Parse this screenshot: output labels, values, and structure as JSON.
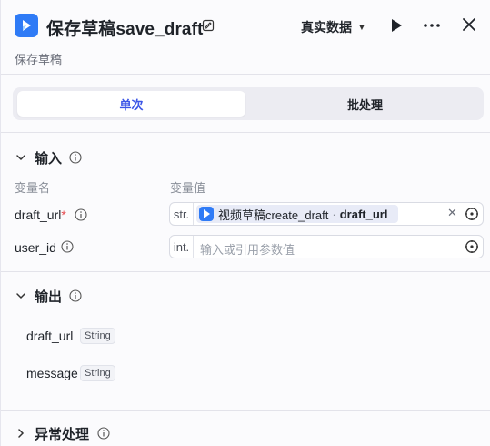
{
  "header": {
    "title": "保存草稿save_draft",
    "subtitle": "保存草稿",
    "mode_label": "真实数据"
  },
  "tabs": [
    {
      "label": "单次",
      "active": true
    },
    {
      "label": "批处理",
      "active": false
    }
  ],
  "input": {
    "title": "输入",
    "col_name": "变量名",
    "col_value": "变量值",
    "params": [
      {
        "name": "draft_url",
        "required": true,
        "type": "str.",
        "ref_node": "视频草稿create_draft",
        "ref_var": "draft_url"
      },
      {
        "name": "user_id",
        "required": false,
        "type": "int.",
        "placeholder": "输入或引用参数值"
      }
    ]
  },
  "output": {
    "title": "输出",
    "fields": [
      {
        "name": "draft_url",
        "type": "String"
      },
      {
        "name": "message",
        "type": "String"
      }
    ]
  },
  "error_handling": {
    "title": "异常处理"
  },
  "colors": {
    "accent": "#3b55e6",
    "brand": "#2f7bf6",
    "required": "#e5484d"
  }
}
